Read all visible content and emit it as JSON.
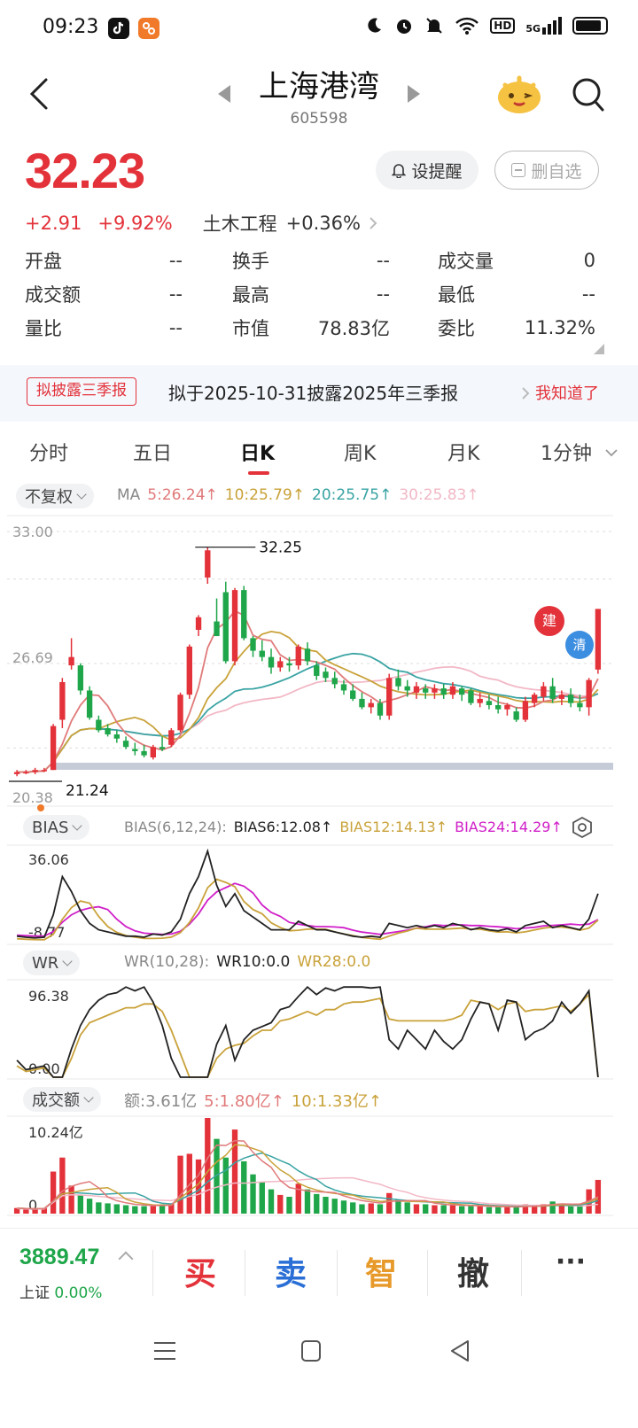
{
  "status_bar": {
    "time": "09:23",
    "network": "HD",
    "signal": "5G"
  },
  "header": {
    "name": "上海港湾",
    "code": "605598"
  },
  "quote": {
    "price": "32.23",
    "change": "+2.91",
    "change_pct": "+9.92%",
    "sector": "土木工程",
    "sector_pct": "+0.36%",
    "alert_label": "设提醒",
    "remove_label": "删自选"
  },
  "stats": {
    "open_label": "开盘",
    "open": "--",
    "turnover_label": "换手",
    "turnover": "--",
    "volume_label": "成交量",
    "volume": "0",
    "amount_label": "成交额",
    "amount": "--",
    "high_label": "最高",
    "high": "--",
    "low_label": "最低",
    "low": "--",
    "vol_ratio_label": "量比",
    "vol_ratio": "--",
    "mcap_label": "市值",
    "mcap": "78.83亿",
    "bid_ratio_label": "委比",
    "bid_ratio": "11.32%"
  },
  "banner": {
    "tag": "拟披露三季报",
    "message": "拟于2025-10-31披露2025年三季报",
    "ack": "我知道了"
  },
  "tabs": [
    "分时",
    "五日",
    "日K",
    "周K",
    "月K",
    "1分钟"
  ],
  "active_tab": "日K",
  "kline": {
    "adjust": "不复权",
    "ma_label": "MA",
    "ma5": "5:26.24↑",
    "ma10": "10:25.79↑",
    "ma20": "20:25.75↑",
    "ma30": "30:25.83↑",
    "axis_top": "33.00",
    "axis_mid": "26.69",
    "axis_bottom": "20.38",
    "high_mark": "32.25",
    "low_mark": "21.24",
    "flag_build": "建",
    "flag_clear": "清",
    "colors": {
      "up": "#e3323a",
      "down": "#1fa64a",
      "ma5": "#e07a7a",
      "ma10": "#c9a23a",
      "ma20": "#3aa3a3",
      "ma30": "#f2b8c6"
    }
  },
  "bias": {
    "label": "BIAS",
    "params": "BIAS(6,12,24):",
    "b6": "BIAS6:12.08↑",
    "b12": "BIAS12:14.13↑",
    "b24": "BIAS24:14.29↑",
    "axis_top": "36.06",
    "axis_bottom": "-8.77"
  },
  "wr": {
    "label": "WR",
    "params": "WR(10,28):",
    "wr10": "WR10:0.0",
    "wr28": "WR28:0.0",
    "axis_top": "96.38",
    "axis_bottom": "0.00"
  },
  "volume": {
    "label": "成交额",
    "amount": "额:3.61亿",
    "ma5": "5:1.80亿↑",
    "ma10": "10:1.33亿↑",
    "axis_top": "10.24亿",
    "axis_bottom": "0"
  },
  "chart_data": {
    "type": "candlestick",
    "ylim": [
      20.38,
      33.0
    ],
    "high_label": 32.25,
    "low_label": 21.24,
    "candles": [
      [
        21.4,
        21.6,
        21.3,
        21.5
      ],
      [
        21.5,
        21.6,
        21.4,
        21.5
      ],
      [
        21.5,
        21.7,
        21.4,
        21.6
      ],
      [
        21.6,
        21.7,
        21.5,
        21.6
      ],
      [
        21.6,
        23.8,
        21.6,
        23.7
      ],
      [
        24.0,
        26.0,
        23.6,
        25.8
      ],
      [
        26.6,
        27.9,
        26.4,
        27.0
      ],
      [
        26.6,
        26.7,
        25.2,
        25.4
      ],
      [
        25.4,
        25.6,
        24.0,
        24.1
      ],
      [
        24.0,
        24.2,
        23.4,
        23.5
      ],
      [
        23.6,
        23.8,
        23.2,
        23.3
      ],
      [
        23.3,
        23.5,
        22.9,
        23.1
      ],
      [
        23.0,
        23.2,
        22.6,
        22.7
      ],
      [
        22.6,
        22.9,
        22.3,
        22.5
      ],
      [
        22.5,
        22.8,
        22.2,
        22.3
      ],
      [
        22.2,
        22.8,
        22.1,
        22.7
      ],
      [
        22.7,
        23.2,
        22.5,
        22.6
      ],
      [
        22.8,
        23.6,
        22.7,
        23.5
      ],
      [
        23.5,
        25.3,
        23.4,
        25.2
      ],
      [
        25.2,
        27.6,
        25.0,
        27.5
      ],
      [
        28.3,
        29.0,
        28.0,
        28.9
      ],
      [
        30.8,
        32.25,
        30.5,
        32.1
      ],
      [
        28.7,
        29.8,
        28.1,
        28.0
      ],
      [
        30.1,
        30.6,
        26.7,
        26.8
      ],
      [
        26.8,
        30.3,
        26.6,
        30.2
      ],
      [
        30.2,
        30.4,
        27.8,
        27.9
      ],
      [
        27.9,
        28.0,
        27.0,
        27.3
      ],
      [
        27.3,
        27.8,
        26.8,
        27.0
      ],
      [
        27.0,
        27.4,
        26.2,
        26.5
      ],
      [
        26.5,
        27.0,
        26.3,
        26.8
      ],
      [
        26.7,
        27.0,
        26.3,
        26.6
      ],
      [
        26.6,
        27.6,
        26.4,
        27.5
      ],
      [
        27.4,
        27.7,
        26.6,
        26.8
      ],
      [
        26.6,
        26.8,
        25.9,
        26.1
      ],
      [
        26.3,
        26.5,
        25.8,
        26.0
      ],
      [
        26.0,
        26.3,
        25.5,
        25.7
      ],
      [
        25.7,
        25.9,
        25.2,
        25.4
      ],
      [
        25.4,
        25.7,
        24.9,
        25.0
      ],
      [
        25.0,
        25.3,
        24.5,
        24.6
      ],
      [
        24.6,
        25.0,
        24.3,
        24.8
      ],
      [
        24.8,
        25.0,
        24.0,
        24.2
      ],
      [
        24.2,
        26.2,
        24.0,
        26.0
      ],
      [
        26.0,
        26.4,
        25.4,
        25.6
      ],
      [
        25.6,
        25.9,
        25.1,
        25.4
      ],
      [
        25.3,
        25.8,
        25.0,
        25.6
      ],
      [
        25.5,
        25.7,
        25.0,
        25.3
      ],
      [
        25.3,
        25.7,
        25.0,
        25.5
      ],
      [
        25.5,
        25.7,
        25.0,
        25.2
      ],
      [
        25.2,
        25.8,
        25.0,
        25.6
      ],
      [
        25.5,
        25.6,
        24.9,
        25.2
      ],
      [
        25.4,
        25.5,
        24.7,
        24.8
      ],
      [
        24.8,
        25.3,
        24.6,
        25.0
      ],
      [
        24.9,
        25.2,
        24.5,
        24.7
      ],
      [
        24.7,
        25.1,
        24.3,
        24.5
      ],
      [
        24.5,
        24.8,
        24.2,
        24.7
      ],
      [
        24.4,
        24.6,
        23.9,
        24.0
      ],
      [
        24.0,
        25.1,
        23.9,
        24.9
      ],
      [
        24.8,
        25.3,
        24.6,
        25.2
      ],
      [
        25.1,
        25.8,
        24.9,
        25.6
      ],
      [
        25.6,
        26.0,
        24.8,
        25.0
      ],
      [
        25.0,
        25.4,
        24.7,
        25.2
      ],
      [
        25.2,
        25.5,
        24.6,
        24.8
      ],
      [
        24.8,
        25.2,
        24.4,
        24.6
      ],
      [
        24.6,
        26.0,
        24.2,
        25.9
      ],
      [
        26.4,
        29.3,
        26.2,
        29.3
      ]
    ],
    "bias6": [
      -6,
      -6.5,
      -6.8,
      -6.5,
      4,
      22,
      15,
      6,
      0,
      -3,
      -4,
      -5,
      -6,
      -6,
      -6.5,
      -5,
      -5.5,
      -4,
      2,
      14,
      22,
      34,
      18,
      8,
      14,
      6,
      3,
      0,
      -3,
      -3,
      -3,
      1,
      -1,
      -3,
      -3,
      -4,
      -5,
      -6,
      -6.5,
      -6,
      -6.5,
      0,
      -1,
      -2,
      -1,
      -2,
      -1,
      -2,
      0,
      -1,
      -3,
      -2,
      -3,
      -3.5,
      -2.5,
      -4,
      -1,
      0,
      1,
      -2,
      -1,
      -2,
      -3,
      2,
      14
    ],
    "wr10": [
      18,
      8,
      10,
      12,
      0,
      0,
      30,
      55,
      72,
      82,
      88,
      90,
      96,
      92,
      96,
      80,
      55,
      20,
      0,
      0,
      0,
      0,
      35,
      55,
      18,
      40,
      50,
      54,
      58,
      72,
      75,
      86,
      96,
      88,
      95,
      92,
      96,
      96,
      96,
      95,
      96,
      40,
      30,
      50,
      40,
      30,
      50,
      38,
      30,
      40,
      62,
      80,
      78,
      50,
      82,
      80,
      40,
      48,
      52,
      60,
      80,
      68,
      78,
      92,
      0
    ],
    "wr28": [
      12,
      6,
      8,
      10,
      0,
      0,
      20,
      45,
      58,
      62,
      66,
      70,
      74,
      74,
      78,
      78,
      70,
      50,
      25,
      0,
      0,
      0,
      20,
      30,
      34,
      36,
      44,
      50,
      50,
      60,
      62,
      66,
      70,
      66,
      72,
      72,
      78,
      80,
      80,
      82,
      84,
      62,
      60,
      60,
      60,
      60,
      60,
      60,
      62,
      66,
      82,
      80,
      78,
      72,
      78,
      80,
      70,
      72,
      72,
      74,
      76,
      70,
      78,
      88,
      0
    ],
    "volume": [
      0.6,
      0.5,
      0.5,
      0.6,
      4.5,
      6.0,
      3.0,
      2.0,
      1.6,
      1.2,
      1.1,
      1.0,
      0.9,
      0.8,
      0.8,
      0.8,
      1.0,
      1.1,
      6.2,
      6.4,
      5.8,
      10.24,
      8.0,
      6.0,
      9.0,
      5.6,
      4.2,
      3.4,
      2.6,
      2.0,
      1.8,
      3.2,
      2.6,
      2.1,
      1.8,
      1.6,
      1.4,
      1.2,
      1.0,
      1.1,
      1.0,
      2.2,
      1.5,
      1.2,
      1.0,
      1.0,
      0.9,
      0.9,
      0.9,
      0.8,
      0.8,
      0.8,
      0.7,
      0.7,
      0.7,
      0.7,
      1.0,
      0.9,
      1.0,
      1.3,
      1.0,
      0.9,
      0.9,
      2.6,
      3.61
    ]
  },
  "trade_bar": {
    "index_value": "3889.47",
    "index_name": "上证",
    "index_pct": "0.00%",
    "buy": "买",
    "sell": "卖",
    "smart": "智",
    "cancel": "撤",
    "more": "···"
  }
}
